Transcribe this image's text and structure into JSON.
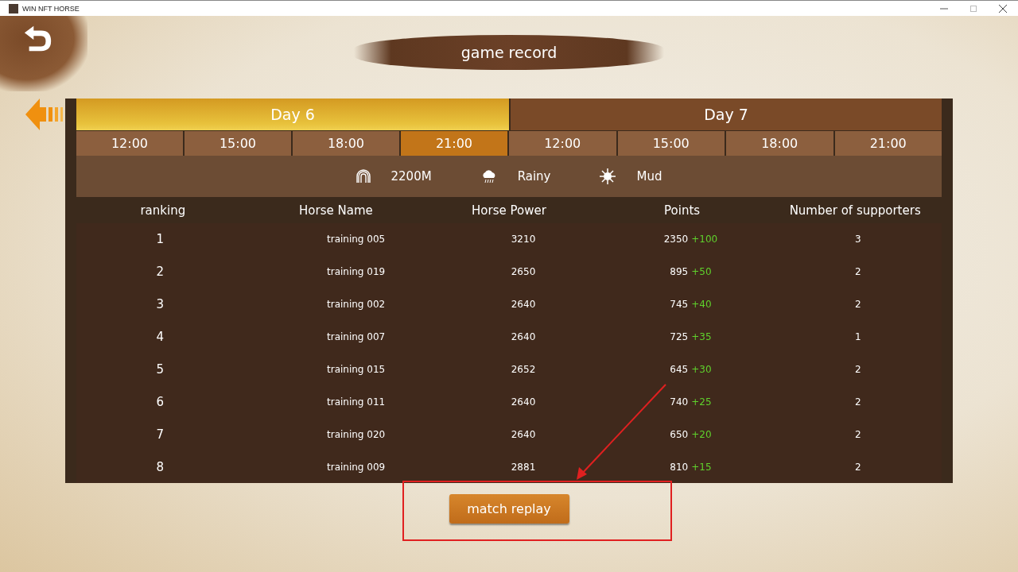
{
  "window": {
    "title": "WIN NFT HORSE"
  },
  "header": {
    "title": "game record"
  },
  "days": [
    {
      "label": "Day 6",
      "selected": true,
      "times": [
        {
          "label": "12:00",
          "selected": false
        },
        {
          "label": "15:00",
          "selected": false
        },
        {
          "label": "18:00",
          "selected": false
        },
        {
          "label": "21:00",
          "selected": true
        }
      ]
    },
    {
      "label": "Day 7",
      "selected": false,
      "times": [
        {
          "label": "12:00",
          "selected": false
        },
        {
          "label": "15:00",
          "selected": false
        },
        {
          "label": "18:00",
          "selected": false
        },
        {
          "label": "21:00",
          "selected": false
        }
      ]
    }
  ],
  "race_info": [
    {
      "kind": "distance",
      "text": "2200M"
    },
    {
      "kind": "weather",
      "text": "Rainy"
    },
    {
      "kind": "track",
      "text": "Mud"
    }
  ],
  "table": {
    "columns": [
      "ranking",
      "Horse Name",
      "Horse Power",
      "Points",
      "Number of supporters"
    ],
    "rows": [
      {
        "ranking": "1",
        "name": "training 005",
        "power": "3210",
        "points": "2350",
        "gain": "+100",
        "supporters": "3"
      },
      {
        "ranking": "2",
        "name": "training 019",
        "power": "2650",
        "points": "895",
        "gain": "+50",
        "supporters": "2"
      },
      {
        "ranking": "3",
        "name": "training 002",
        "power": "2640",
        "points": "745",
        "gain": "+40",
        "supporters": "2"
      },
      {
        "ranking": "4",
        "name": "training 007",
        "power": "2640",
        "points": "725",
        "gain": "+35",
        "supporters": "1"
      },
      {
        "ranking": "5",
        "name": "training 015",
        "power": "2652",
        "points": "645",
        "gain": "+30",
        "supporters": "2"
      },
      {
        "ranking": "6",
        "name": "training 011",
        "power": "2640",
        "points": "740",
        "gain": "+25",
        "supporters": "2"
      },
      {
        "ranking": "7",
        "name": "training 020",
        "power": "2640",
        "points": "650",
        "gain": "+20",
        "supporters": "2"
      },
      {
        "ranking": "8",
        "name": "training 009",
        "power": "2881",
        "points": "810",
        "gain": "+15",
        "supporters": "2"
      }
    ]
  },
  "replay_button": "match replay"
}
